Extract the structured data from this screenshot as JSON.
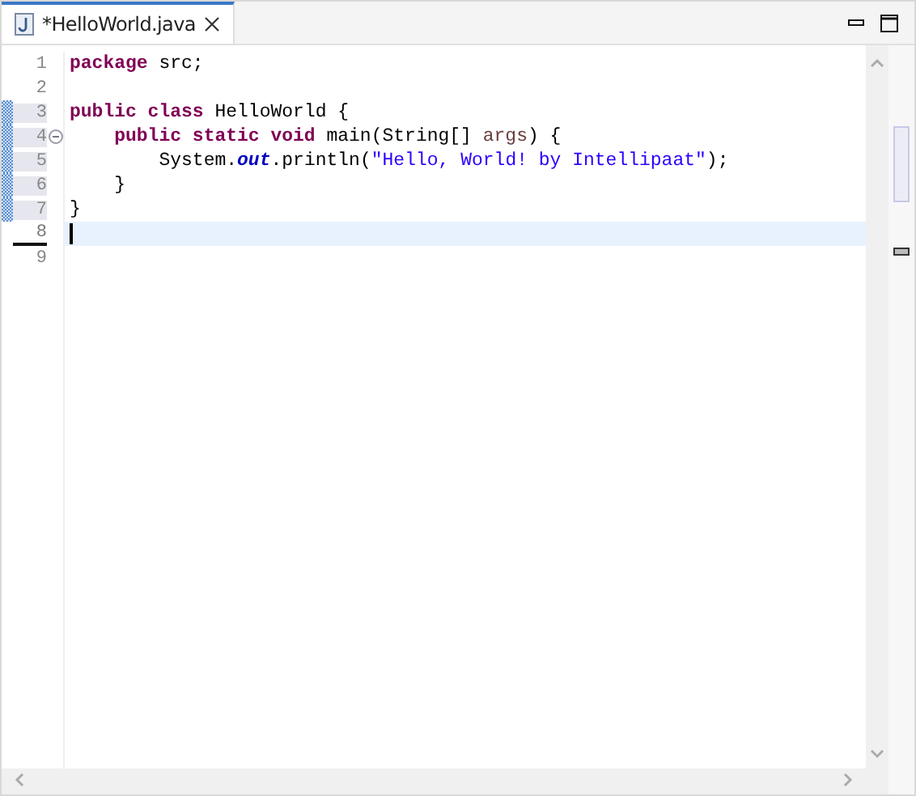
{
  "tab": {
    "label": "*HelloWorld.java",
    "selected": true
  },
  "lines": [
    {
      "number": "1",
      "changed": false,
      "current": false,
      "fold": false,
      "tokens": [
        {
          "kind": "keyword",
          "text": "package"
        },
        {
          "kind": "plain",
          "text": " src;"
        }
      ]
    },
    {
      "number": "2",
      "changed": false,
      "current": false,
      "fold": false
    },
    {
      "number": "3",
      "changed": true,
      "current": false,
      "fold": false,
      "tokens": [
        {
          "kind": "keyword",
          "text": "public class"
        },
        {
          "kind": "plain",
          "text": " HelloWorld {"
        }
      ]
    },
    {
      "number": "4",
      "changed": true,
      "current": false,
      "fold": true,
      "tokens": [
        {
          "kind": "keyword",
          "text": "    public static void"
        },
        {
          "kind": "plain",
          "text": " main(String[] "
        },
        {
          "kind": "param",
          "text": "args"
        },
        {
          "kind": "plain",
          "text": ") {"
        }
      ]
    },
    {
      "number": "5",
      "changed": true,
      "current": false,
      "fold": false,
      "tokens": [
        {
          "kind": "plain",
          "text": "        System."
        },
        {
          "kind": "field",
          "text": "out"
        },
        {
          "kind": "plain",
          "text": ".println("
        },
        {
          "kind": "string",
          "text": "\"Hello, World! by Intellipaat\""
        },
        {
          "kind": "plain",
          "text": ");"
        }
      ]
    },
    {
      "number": "6",
      "changed": true,
      "current": false,
      "fold": false,
      "tokens": [
        {
          "kind": "plain",
          "text": "    }"
        }
      ]
    },
    {
      "number": "7",
      "changed": true,
      "current": false,
      "fold": false,
      "tokens": [
        {
          "kind": "plain",
          "text": "}"
        }
      ]
    },
    {
      "number": "8",
      "changed": false,
      "current": true,
      "fold": false
    },
    {
      "number": "9",
      "changed": false,
      "current": false,
      "fold": false
    }
  ]
}
